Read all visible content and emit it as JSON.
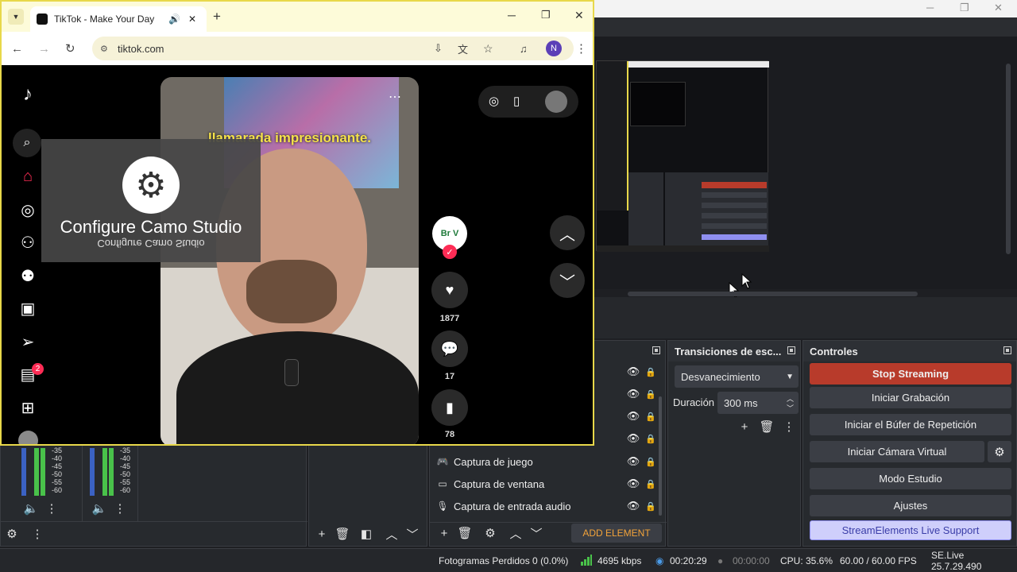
{
  "browser": {
    "tab_title": "TikTok - Make Your Day",
    "url": "tiktok.com",
    "profile_initial": "N"
  },
  "tiktok": {
    "caption": "llamarada impresionante.",
    "overlay_title": "Configure Camo Studio",
    "overlay_mirror": "Configure Camo Studio",
    "inbox_badge": "2",
    "likes": "1877",
    "comments": "17",
    "saves": "78",
    "creator_badge": "Br V"
  },
  "audio_mixer": {
    "scale": [
      "-35",
      "-40",
      "-45",
      "-50",
      "-55",
      "-60"
    ]
  },
  "sources": {
    "items": [
      "Captura de juego",
      "Captura de ventana",
      "Captura de entrada audio"
    ],
    "add_element": "ADD ELEMENT"
  },
  "transitions": {
    "title": "Transiciones de esc...",
    "selected": "Desvanecimiento",
    "duration_label": "Duración",
    "duration_value": "300 ms"
  },
  "controls": {
    "title": "Controles",
    "stop_streaming": "Stop Streaming",
    "start_recording": "Iniciar Grabación",
    "replay_buffer": "Iniciar el Búfer de Repetición",
    "virtual_camera": "Iniciar Cámara Virtual",
    "studio_mode": "Modo Estudio",
    "settings": "Ajustes",
    "streamelements": "StreamElements Live Support"
  },
  "status": {
    "dropped_frames": "Fotogramas Perdidos 0 (0.0%)",
    "bitrate": "4695 kbps",
    "stream_time": "00:20:29",
    "rec_time": "00:00:00",
    "cpu": "CPU: 35.6%",
    "fps": "60.00 / 60.00 FPS",
    "version": "SE.Live 25.7.29.490"
  },
  "colors": {
    "stop_streaming": "#b83b2b",
    "streamelements": "#cfcffb",
    "window_border": "#e8d84a"
  }
}
